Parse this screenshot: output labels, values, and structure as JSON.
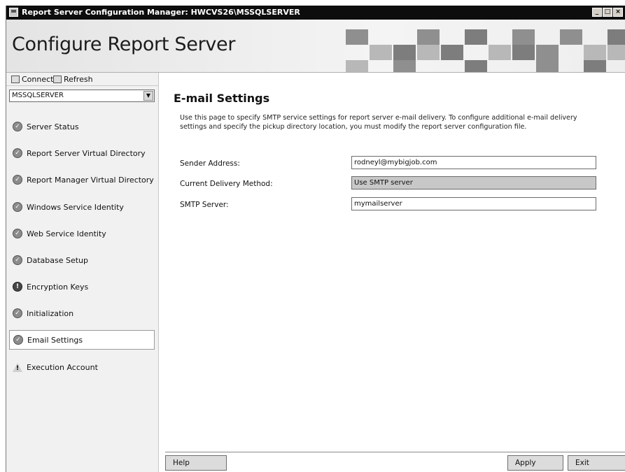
{
  "window": {
    "title": "Report Server Configuration Manager: HWCVS26\\MSSQLSERVER",
    "minimize_glyph": "_",
    "maximize_glyph": "□",
    "close_glyph": "×"
  },
  "banner": {
    "title": "Configure Report Server"
  },
  "toolbar": {
    "connect_label": "Connect",
    "connect_icon": "connect-icon",
    "refresh_label": "Refresh",
    "refresh_icon": "refresh-icon"
  },
  "server_select": {
    "value": "MSSQLSERVER",
    "arrow": "▼"
  },
  "nav": {
    "items": [
      {
        "label": "Server Status",
        "status": "check"
      },
      {
        "label": "Report Server Virtual Directory",
        "status": "check"
      },
      {
        "label": "Report Manager Virtual Directory",
        "status": "check"
      },
      {
        "label": "Windows Service Identity",
        "status": "check"
      },
      {
        "label": "Web Service Identity",
        "status": "check"
      },
      {
        "label": "Database Setup",
        "status": "check"
      },
      {
        "label": "Encryption Keys",
        "status": "info"
      },
      {
        "label": "Initialization",
        "status": "check"
      },
      {
        "label": "Email Settings",
        "status": "check",
        "selected": true
      },
      {
        "label": "Execution Account",
        "status": "warning"
      }
    ]
  },
  "page": {
    "title": "E-mail Settings",
    "description": "Use this page to specify SMTP service settings for report server e-mail delivery. To configure additional e-mail delivery settings and specify the pickup directory location, you must modify the report server configuration file."
  },
  "form": {
    "sender_address": {
      "label": "Sender Address:",
      "value": "rodneyl@mybigjob.com"
    },
    "delivery_method": {
      "label": "Current Delivery Method:",
      "value": "Use SMTP server"
    },
    "smtp_server": {
      "label": "SMTP Server:",
      "value": "mymailserver"
    }
  },
  "buttons": {
    "help": "Help",
    "apply": "Apply",
    "exit": "Exit"
  }
}
